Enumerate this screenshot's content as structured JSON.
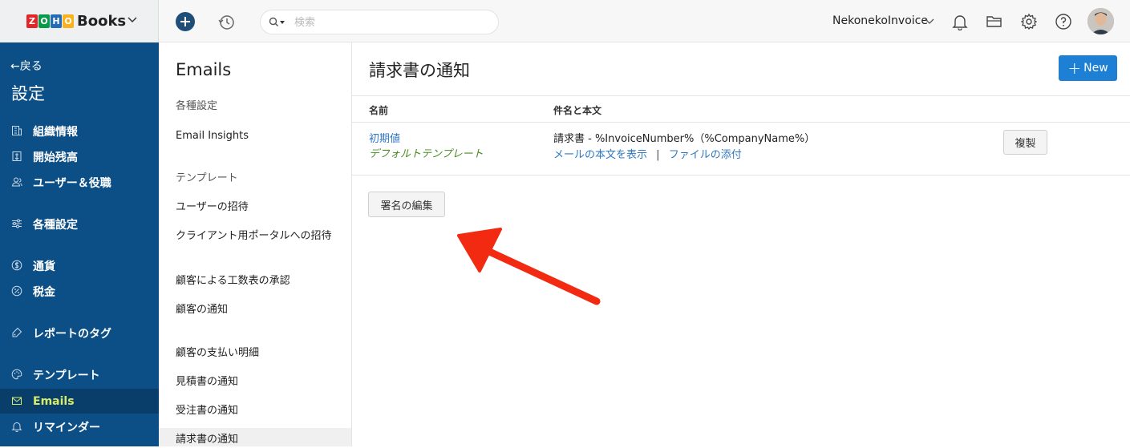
{
  "brand": {
    "logo_letters": [
      "Z",
      "O",
      "H",
      "O"
    ],
    "logo_colors": [
      "#e42527",
      "#089949",
      "#226db4",
      "#f9b21d"
    ],
    "product": "Books"
  },
  "topbar": {
    "search_placeholder": "検索",
    "org_name": "NekonekoInvoice",
    "icons": [
      "add-icon",
      "history-icon",
      "search-icon",
      "bell-icon",
      "folder-icon",
      "gear-icon",
      "help-icon"
    ]
  },
  "sidebar": {
    "back_label": "←戻る",
    "title": "設定",
    "items": [
      {
        "label": "組織情報",
        "icon": "building-icon"
      },
      {
        "label": "開始残高",
        "icon": "balance-icon"
      },
      {
        "label": "ユーザー＆役職",
        "icon": "users-icon"
      },
      {
        "label": "各種設定",
        "icon": "sliders-icon"
      },
      {
        "label": "通貨",
        "icon": "currency-icon"
      },
      {
        "label": "税金",
        "icon": "percent-icon"
      },
      {
        "label": "レポートのタグ",
        "icon": "tag-icon"
      },
      {
        "label": "テンプレート",
        "icon": "palette-icon"
      },
      {
        "label": "Emails",
        "icon": "mail-icon",
        "active": true
      },
      {
        "label": "リマインダー",
        "icon": "bell-icon"
      }
    ]
  },
  "subnav": {
    "title": "Emails",
    "items": [
      {
        "label": "各種設定"
      },
      {
        "label": "Email Insights"
      },
      {
        "label": "テンプレート"
      },
      {
        "label": "ユーザーの招待"
      },
      {
        "label": "クライアント用ポータルへの招待"
      },
      {
        "label": "顧客による工数表の承認"
      },
      {
        "label": "顧客の通知"
      },
      {
        "label": "顧客の支払い明細"
      },
      {
        "label": "見積書の通知"
      },
      {
        "label": "受注書の通知"
      },
      {
        "label": "請求書の通知"
      }
    ]
  },
  "main": {
    "title": "請求書の通知",
    "new_label": "New",
    "columns": [
      "名前",
      "件名と本文"
    ],
    "row": {
      "name": "初期値",
      "default_label": "デフォルトテンプレート",
      "subject": "請求書 - %InvoiceNumber%（%CompanyName%）",
      "view_link": "メールの本文を表示",
      "separator": "|",
      "attach_link": "ファイルの添付",
      "clone_label": "複製"
    },
    "edit_signature_label": "署名の編集"
  }
}
